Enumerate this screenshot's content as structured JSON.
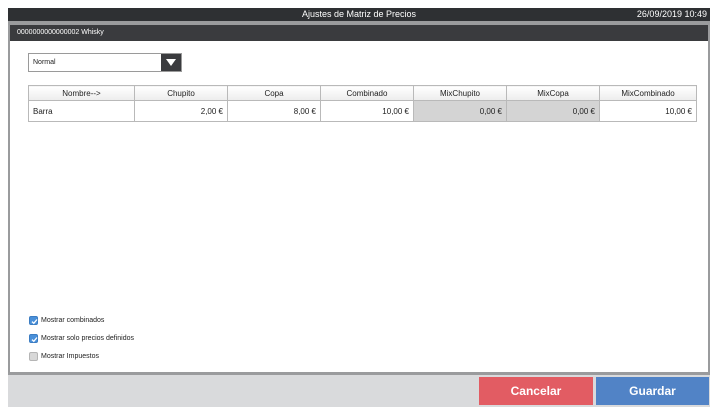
{
  "titlebar": {
    "title": "Ajustes de Matriz de Precios",
    "datetime": "26/09/2019 10:49"
  },
  "panel": {
    "header": "0000000000000002 Whisky"
  },
  "dropdown": {
    "selected": "Normal"
  },
  "table": {
    "columns": [
      "Nombre-->",
      "Chupito",
      "Copa",
      "Combinado",
      "MixChupito",
      "MixCopa",
      "MixCombinado"
    ],
    "rows": [
      {
        "name": "Barra",
        "values": [
          "2,00 €",
          "8,00 €",
          "10,00 €",
          "0,00 €",
          "0,00 €",
          "10,00 €"
        ],
        "disabled": [
          false,
          false,
          false,
          true,
          true,
          false
        ]
      }
    ]
  },
  "checkboxes": [
    {
      "label": "Mostrar combinados",
      "checked": true
    },
    {
      "label": "Mostrar solo precios definidos",
      "checked": true
    },
    {
      "label": "Mostrar Impuestos",
      "checked": false
    }
  ],
  "buttons": {
    "cancel": "Cancelar",
    "save": "Guardar"
  },
  "colors": {
    "cancel": "#e25c63",
    "save": "#5183c6",
    "checkbox_checked": "#4a90d9",
    "titlebar": "#2e3033"
  }
}
